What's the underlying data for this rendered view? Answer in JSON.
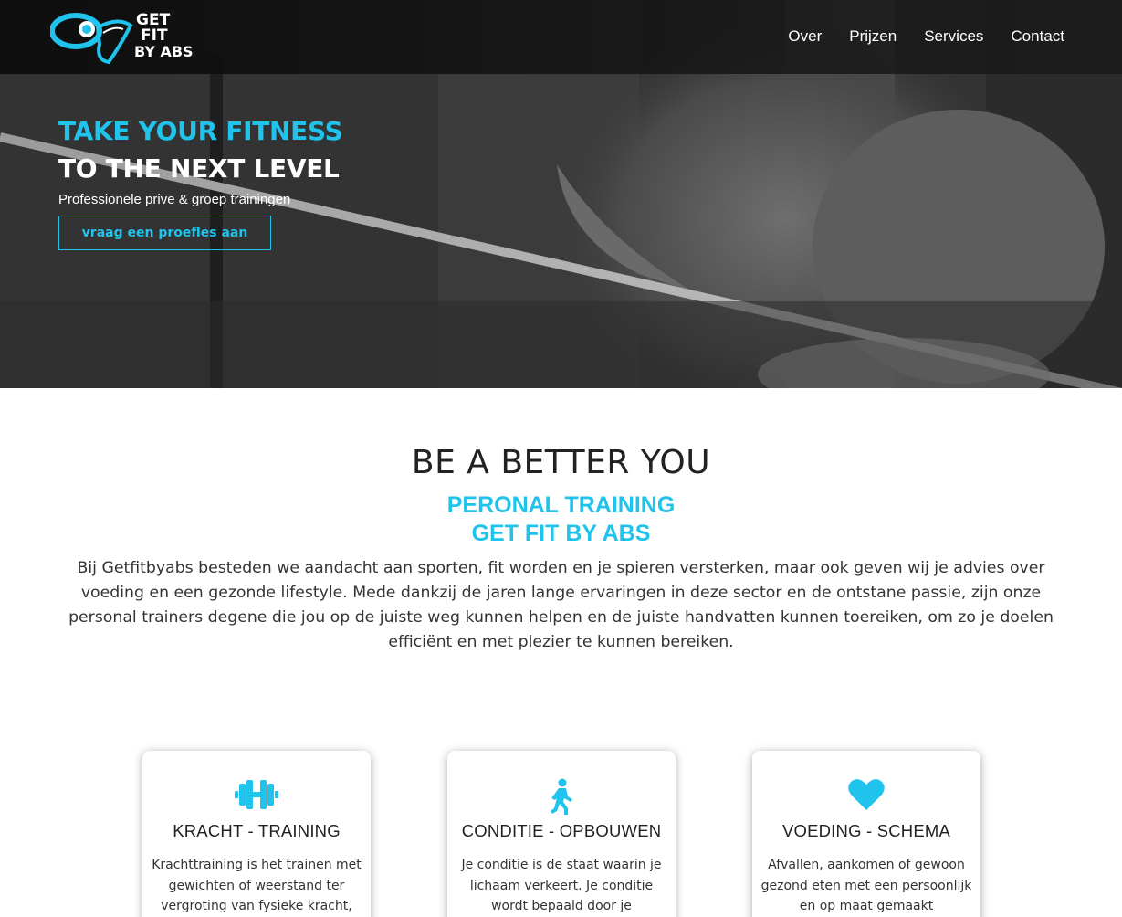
{
  "colors": {
    "accent": "#1fc3ec",
    "nav_bg": "#111111",
    "text_dark": "#222222"
  },
  "brand": {
    "logo_line1": "GET",
    "logo_line2": "FIT",
    "logo_line3": "BY ABS",
    "logo_icon": "dumbbell-logo-icon"
  },
  "nav": {
    "items": [
      {
        "label": "Over"
      },
      {
        "label": "Prijzen"
      },
      {
        "label": "Services"
      },
      {
        "label": "Contact"
      }
    ]
  },
  "hero": {
    "title_line1": "TAKE YOUR FITNESS",
    "title_line2": "TO THE NEXT LEVEL",
    "subtitle": "Professionele prive & groep trainingen",
    "cta_label": "vraag een proefles aan"
  },
  "intro": {
    "title": "BE A BETTER YOU",
    "subtitle_line1": "PERONAL TRAINING",
    "subtitle_line2": "GET FIT BY ABS",
    "text": "Bij Getfitbyabs besteden we aandacht aan sporten, fit worden en je spieren versterken, maar ook geven wij je advies over voeding en een gezonde lifestyle. Mede dankzij de jaren lange ervaringen in deze sector en de ontstane passie, zijn onze personal trainers degene die jou op de juiste weg kunnen helpen en de juiste handvatten kunnen toereiken, om zo je doelen efficiënt en met plezier te kunnen bereiken."
  },
  "cards": [
    {
      "icon": "dumbbell-icon",
      "title": "KRACHT - TRAINING",
      "text": "Krachttraining is het trainen met gewichten of weerstand ter vergroting van fysieke kracht,"
    },
    {
      "icon": "walking-icon",
      "title": "CONDITIE - OPBOUWEN",
      "text": "Je conditie is de staat waarin je lichaam verkeert. Je conditie wordt bepaald door je"
    },
    {
      "icon": "heart-icon",
      "title": "VOEDING - SCHEMA",
      "text": "Afvallen, aankomen of gewoon gezond eten met een persoonlijk en op maat gemaakt"
    }
  ]
}
